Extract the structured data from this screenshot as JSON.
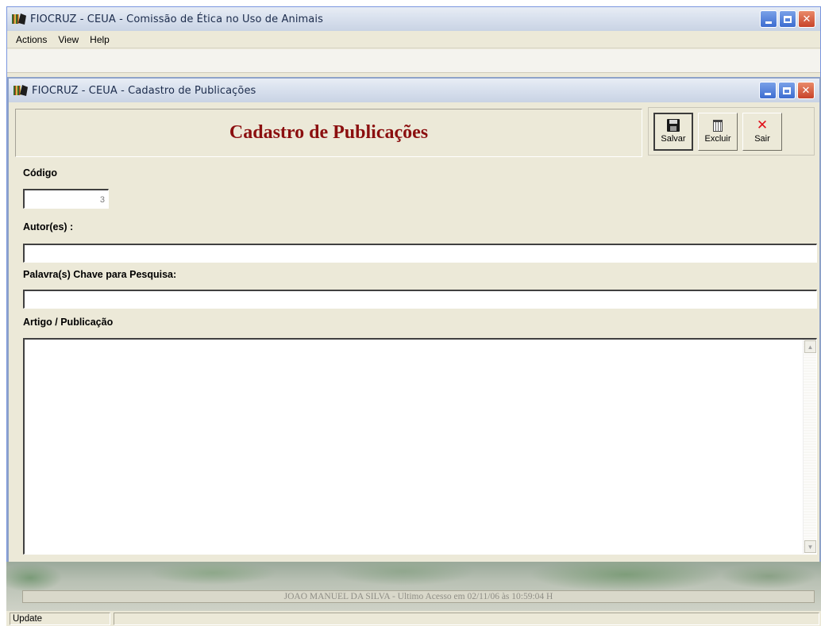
{
  "main_window": {
    "title": "FIOCRUZ - CEUA - Comissão de Ética no Uso de Animais",
    "menu": [
      "Actions",
      "View",
      "Help"
    ]
  },
  "child_window": {
    "title": "FIOCRUZ - CEUA - Cadastro de Publicações",
    "header_title": "Cadastro de Publicações",
    "actions": {
      "save_label": "Salvar",
      "delete_label": "Excluir",
      "exit_label": "Sair"
    },
    "fields": {
      "code_label": "Código",
      "code_value": "3",
      "authors_label": "Autor(es) :",
      "authors_value": "",
      "keywords_label": "Palavra(s) Chave para Pesquisa:",
      "keywords_value": "",
      "article_label": "Artigo / Publicação",
      "article_value": ""
    }
  },
  "footer": {
    "user_info": "JOAO MANUEL DA SILVA - Ultimo Acesso em 02/11/06 às 10:59:04 H"
  },
  "statusbar": {
    "panel_1": "Update",
    "panel_2": ""
  },
  "colors": {
    "header_title": "#8b0f0f",
    "window_face": "#ece9d8",
    "close_button": "#c8432a",
    "exit_icon": "#e0101a"
  },
  "icons": [
    "app-icon",
    "minimize-icon",
    "maximize-icon",
    "close-icon",
    "floppy-disk-icon",
    "trash-icon",
    "red-x-icon"
  ]
}
